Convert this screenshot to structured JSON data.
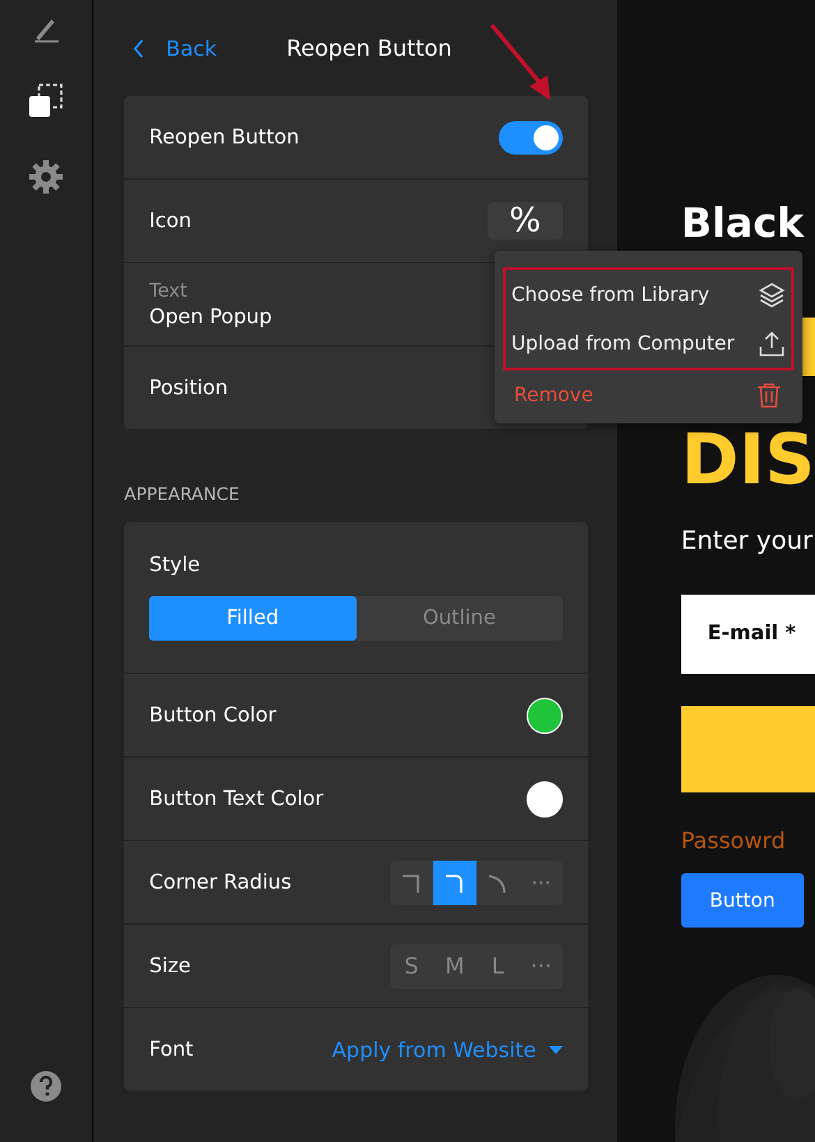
{
  "header": {
    "back": "Back",
    "title": "Reopen Button"
  },
  "main_group": [
    {
      "kind": "toggle",
      "label": "Reopen Button",
      "on": true
    },
    {
      "kind": "icon",
      "label": "Icon",
      "value": "%"
    },
    {
      "kind": "text",
      "label": "Text",
      "value": "Open Popup"
    },
    {
      "kind": "plain",
      "label": "Position"
    }
  ],
  "appearance": {
    "heading": "APPEARANCE",
    "rows": [
      {
        "kind": "segmented",
        "label": "Style",
        "options": [
          {
            "label": "Filled",
            "selected": true
          },
          {
            "label": "Outline",
            "selected": false
          }
        ]
      },
      {
        "kind": "color",
        "label": "Button Color",
        "color": "#1fc43a"
      },
      {
        "kind": "color",
        "label": "Button Text Color",
        "color": "#ffffff"
      },
      {
        "kind": "corners",
        "label": "Corner Radius",
        "options": [
          {
            "kind": "square",
            "selected": false
          },
          {
            "kind": "rounded",
            "selected": true
          },
          {
            "kind": "curve",
            "selected": false
          },
          {
            "kind": "more",
            "text": "···",
            "selected": false
          }
        ]
      },
      {
        "kind": "sizes",
        "label": "Size",
        "options": [
          {
            "text": "S",
            "selected": false
          },
          {
            "text": "M",
            "selected": false
          },
          {
            "text": "L",
            "selected": false
          },
          {
            "text": "···",
            "selected": false
          }
        ]
      },
      {
        "kind": "dropdown",
        "label": "Font",
        "value": "Apply from Website"
      }
    ]
  },
  "icon_menu": {
    "items": [
      {
        "kind": "library",
        "label": "Choose from Library",
        "outlined": true
      },
      {
        "kind": "upload",
        "label": "Upload from Computer",
        "outlined": true
      },
      {
        "kind": "remove",
        "label": "Remove",
        "outlined": false
      }
    ]
  },
  "preview": {
    "heading": "Black",
    "heading_2": "DIS",
    "prompt": "Enter your",
    "email_placeholder": "E-mail *",
    "password_label": "Passowrd",
    "button": "Button"
  }
}
